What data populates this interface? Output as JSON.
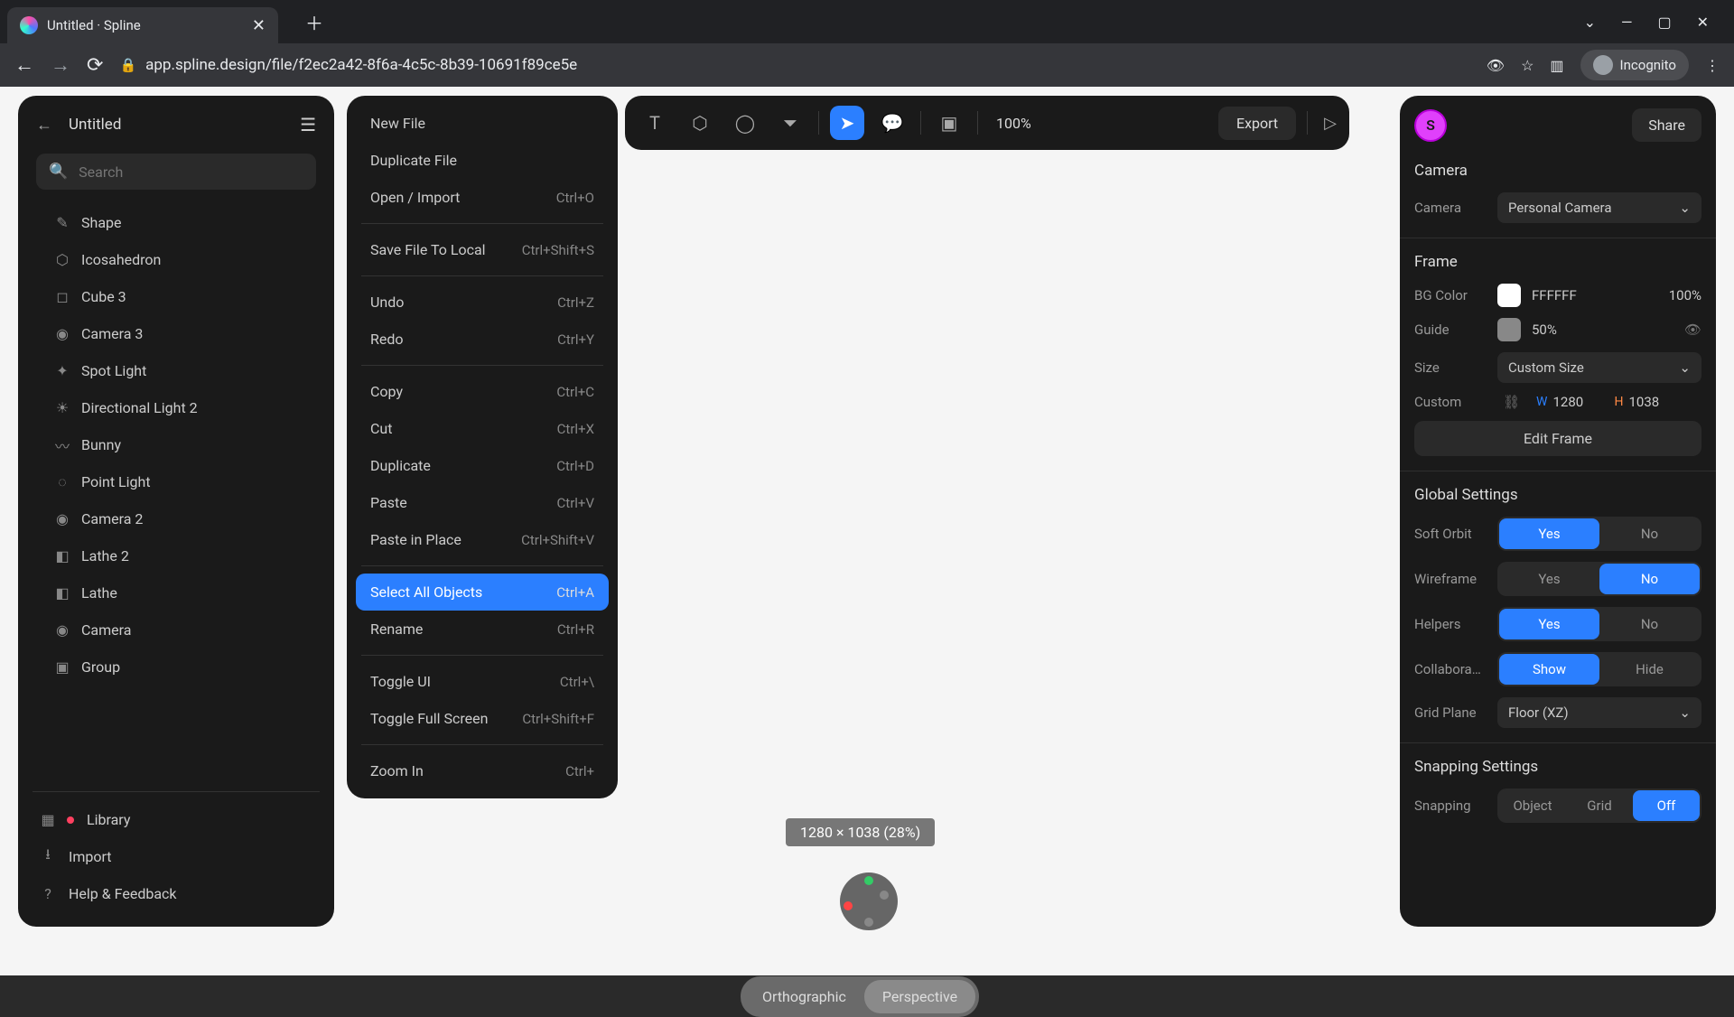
{
  "browser": {
    "tab_title": "Untitled · Spline",
    "url": "app.spline.design/file/f2ec2a42-8f6a-4c5c-8b39-10691f89ce5e",
    "incognito_label": "Incognito"
  },
  "left": {
    "title": "Untitled",
    "search_placeholder": "Search",
    "tree": [
      {
        "label": "Shape",
        "icon": "pen"
      },
      {
        "label": "Icosahedron",
        "icon": "poly"
      },
      {
        "label": "Cube 3",
        "icon": "cube"
      },
      {
        "label": "Camera 3",
        "icon": "camera"
      },
      {
        "label": "Spot Light",
        "icon": "light"
      },
      {
        "label": "Directional Light 2",
        "icon": "sun"
      },
      {
        "label": "Bunny",
        "icon": "path"
      },
      {
        "label": "Point Light",
        "icon": "bulb"
      },
      {
        "label": "Camera 2",
        "icon": "camera"
      },
      {
        "label": "Lathe 2",
        "icon": "lathe"
      },
      {
        "label": "Lathe",
        "icon": "lathe"
      },
      {
        "label": "Camera",
        "icon": "camera"
      },
      {
        "label": "Group",
        "icon": "group"
      }
    ],
    "library_label": "Library",
    "import_label": "Import",
    "help_label": "Help & Feedback"
  },
  "menu": {
    "items": [
      {
        "label": "New File",
        "sc": ""
      },
      {
        "label": "Duplicate File",
        "sc": ""
      },
      {
        "label": "Open / Import",
        "sc": "Ctrl+O"
      },
      {
        "sep": true
      },
      {
        "label": "Save File To Local",
        "sc": "Ctrl+Shift+S"
      },
      {
        "sep": true
      },
      {
        "label": "Undo",
        "sc": "Ctrl+Z"
      },
      {
        "label": "Redo",
        "sc": "Ctrl+Y"
      },
      {
        "sep": true
      },
      {
        "label": "Copy",
        "sc": "Ctrl+C"
      },
      {
        "label": "Cut",
        "sc": "Ctrl+X"
      },
      {
        "label": "Duplicate",
        "sc": "Ctrl+D"
      },
      {
        "label": "Paste",
        "sc": "Ctrl+V"
      },
      {
        "label": "Paste in Place",
        "sc": "Ctrl+Shift+V"
      },
      {
        "sep": true
      },
      {
        "label": "Select All Objects",
        "sc": "Ctrl+A",
        "active": true
      },
      {
        "label": "Rename",
        "sc": "Ctrl+R"
      },
      {
        "sep": true
      },
      {
        "label": "Toggle UI",
        "sc": "Ctrl+\\"
      },
      {
        "label": "Toggle Full Screen",
        "sc": "Ctrl+Shift+F"
      },
      {
        "sep": true
      },
      {
        "label": "Zoom In",
        "sc": "Ctrl+"
      }
    ]
  },
  "toolbar": {
    "zoom": "100%",
    "export_label": "Export"
  },
  "viewport": {
    "dims_label": "1280 × 1038 (28%)",
    "ortho": "Orthographic",
    "persp": "Perspective"
  },
  "right": {
    "avatar_initial": "S",
    "share": "Share",
    "camera_title": "Camera",
    "camera_label": "Camera",
    "camera_value": "Personal Camera",
    "frame_title": "Frame",
    "bg_label": "BG Color",
    "bg_hex": "FFFFFF",
    "bg_opacity": "100%",
    "guide_label": "Guide",
    "guide_opacity": "50%",
    "size_label": "Size",
    "size_value": "Custom Size",
    "custom_label": "Custom",
    "w_label": "W",
    "w_value": "1280",
    "h_label": "H",
    "h_value": "1038",
    "edit_frame": "Edit Frame",
    "global_title": "Global Settings",
    "soft_orbit": "Soft Orbit",
    "wireframe": "Wireframe",
    "helpers": "Helpers",
    "collab": "Collabora…",
    "grid_plane": "Grid Plane",
    "grid_plane_value": "Floor (XZ)",
    "yes": "Yes",
    "no": "No",
    "show": "Show",
    "hide": "Hide",
    "snapping_title": "Snapping Settings",
    "snapping": "Snapping",
    "snap_object": "Object",
    "snap_grid": "Grid",
    "snap_off": "Off"
  }
}
